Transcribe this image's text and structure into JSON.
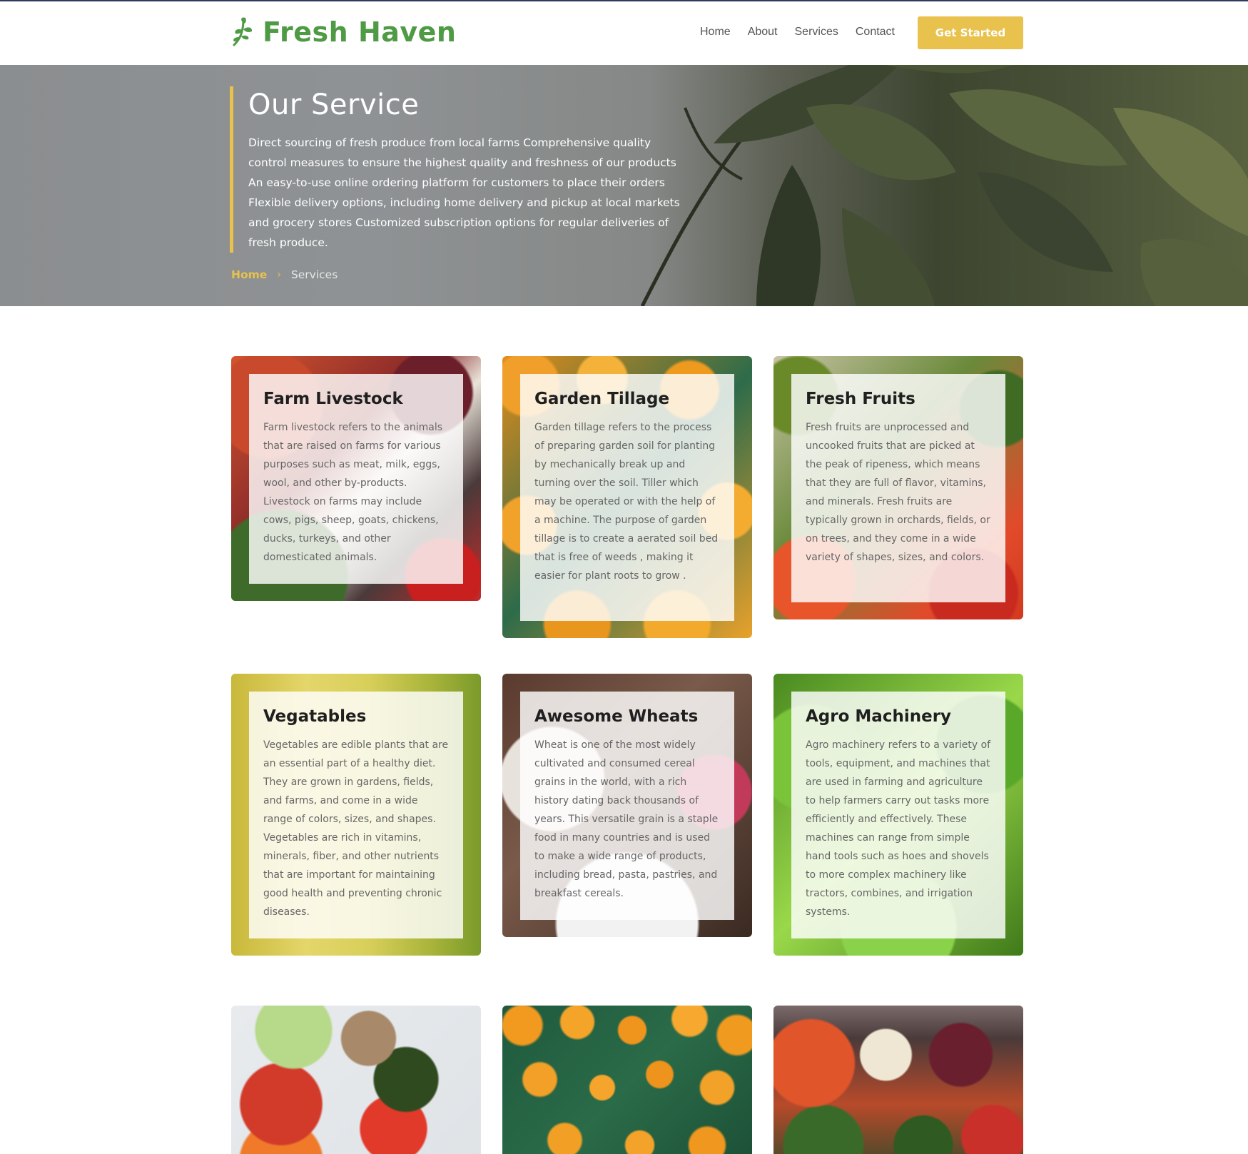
{
  "header": {
    "brand": "Fresh Haven",
    "nav": [
      "Home",
      "About",
      "Services",
      "Contact"
    ],
    "cta": "Get Started"
  },
  "hero": {
    "title": "Our Service",
    "description": "Direct sourcing of fresh produce from local farms Comprehensive quality control measures to ensure the highest quality and freshness of our products An easy-to-use online ordering platform for customers to place their orders Flexible delivery options, including home delivery and pickup at local markets and grocery stores Customized subscription options for regular deliveries of fresh produce.",
    "breadcrumb": {
      "home": "Home",
      "separator": "›",
      "current": "Services"
    }
  },
  "cards": [
    {
      "title": "Farm Livestock",
      "text": "Farm livestock refers to the animals that are raised on farms for various purposes such as meat, milk, eggs, wool, and other by-products. Livestock on farms may include cows, pigs, sheep, goats, chickens, ducks, turkeys, and other domesticated animals."
    },
    {
      "title": "Garden Tillage",
      "text": "Garden tillage refers to the process of preparing garden soil for planting by mechanically break up and turning over the soil. Tiller which may be operated or with the help of a machine. The purpose of garden tillage is to create a aerated soil bed that is free of weeds , making it easier for plant roots to grow ."
    },
    {
      "title": "Fresh Fruits",
      "text": "Fresh fruits are unprocessed and uncooked fruits that are picked at the peak of ripeness, which means that they are full of flavor, vitamins, and minerals. Fresh fruits are typically grown in orchards, fields, or on trees, and they come in a wide variety of shapes, sizes, and colors."
    },
    {
      "title": "Vegatables",
      "text": "Vegetables are edible plants that are an essential part of a healthy diet. They are grown in gardens, fields, and farms, and come in a wide range of colors, sizes, and shapes. Vegetables are rich in vitamins, minerals, fiber, and other nutrients that are important for maintaining good health and preventing chronic diseases."
    },
    {
      "title": "Awesome Wheats",
      "text": "Wheat is one of the most widely cultivated and consumed cereal grains in the world, with a rich history dating back thousands of years. This versatile grain is a staple food in many countries and is used to make a wide range of products, including bread, pasta, pastries, and breakfast cereals."
    },
    {
      "title": "Agro Machinery",
      "text": "Agro machinery refers to a variety of tools, equipment, and machines that are used in farming and agriculture to help farmers carry out tasks more efficiently and effectively. These machines can range from simple hand tools such as hoes and shovels to more complex machinery like tractors, combines, and irrigation systems."
    }
  ],
  "colors": {
    "brand_green": "#4f9a44",
    "accent_gold": "#e8c24d",
    "top_rule": "#2f3b5c"
  },
  "icons": {
    "brand": "leaf-sprig-icon",
    "breadcrumb_separator": "chevron-right-icon"
  }
}
